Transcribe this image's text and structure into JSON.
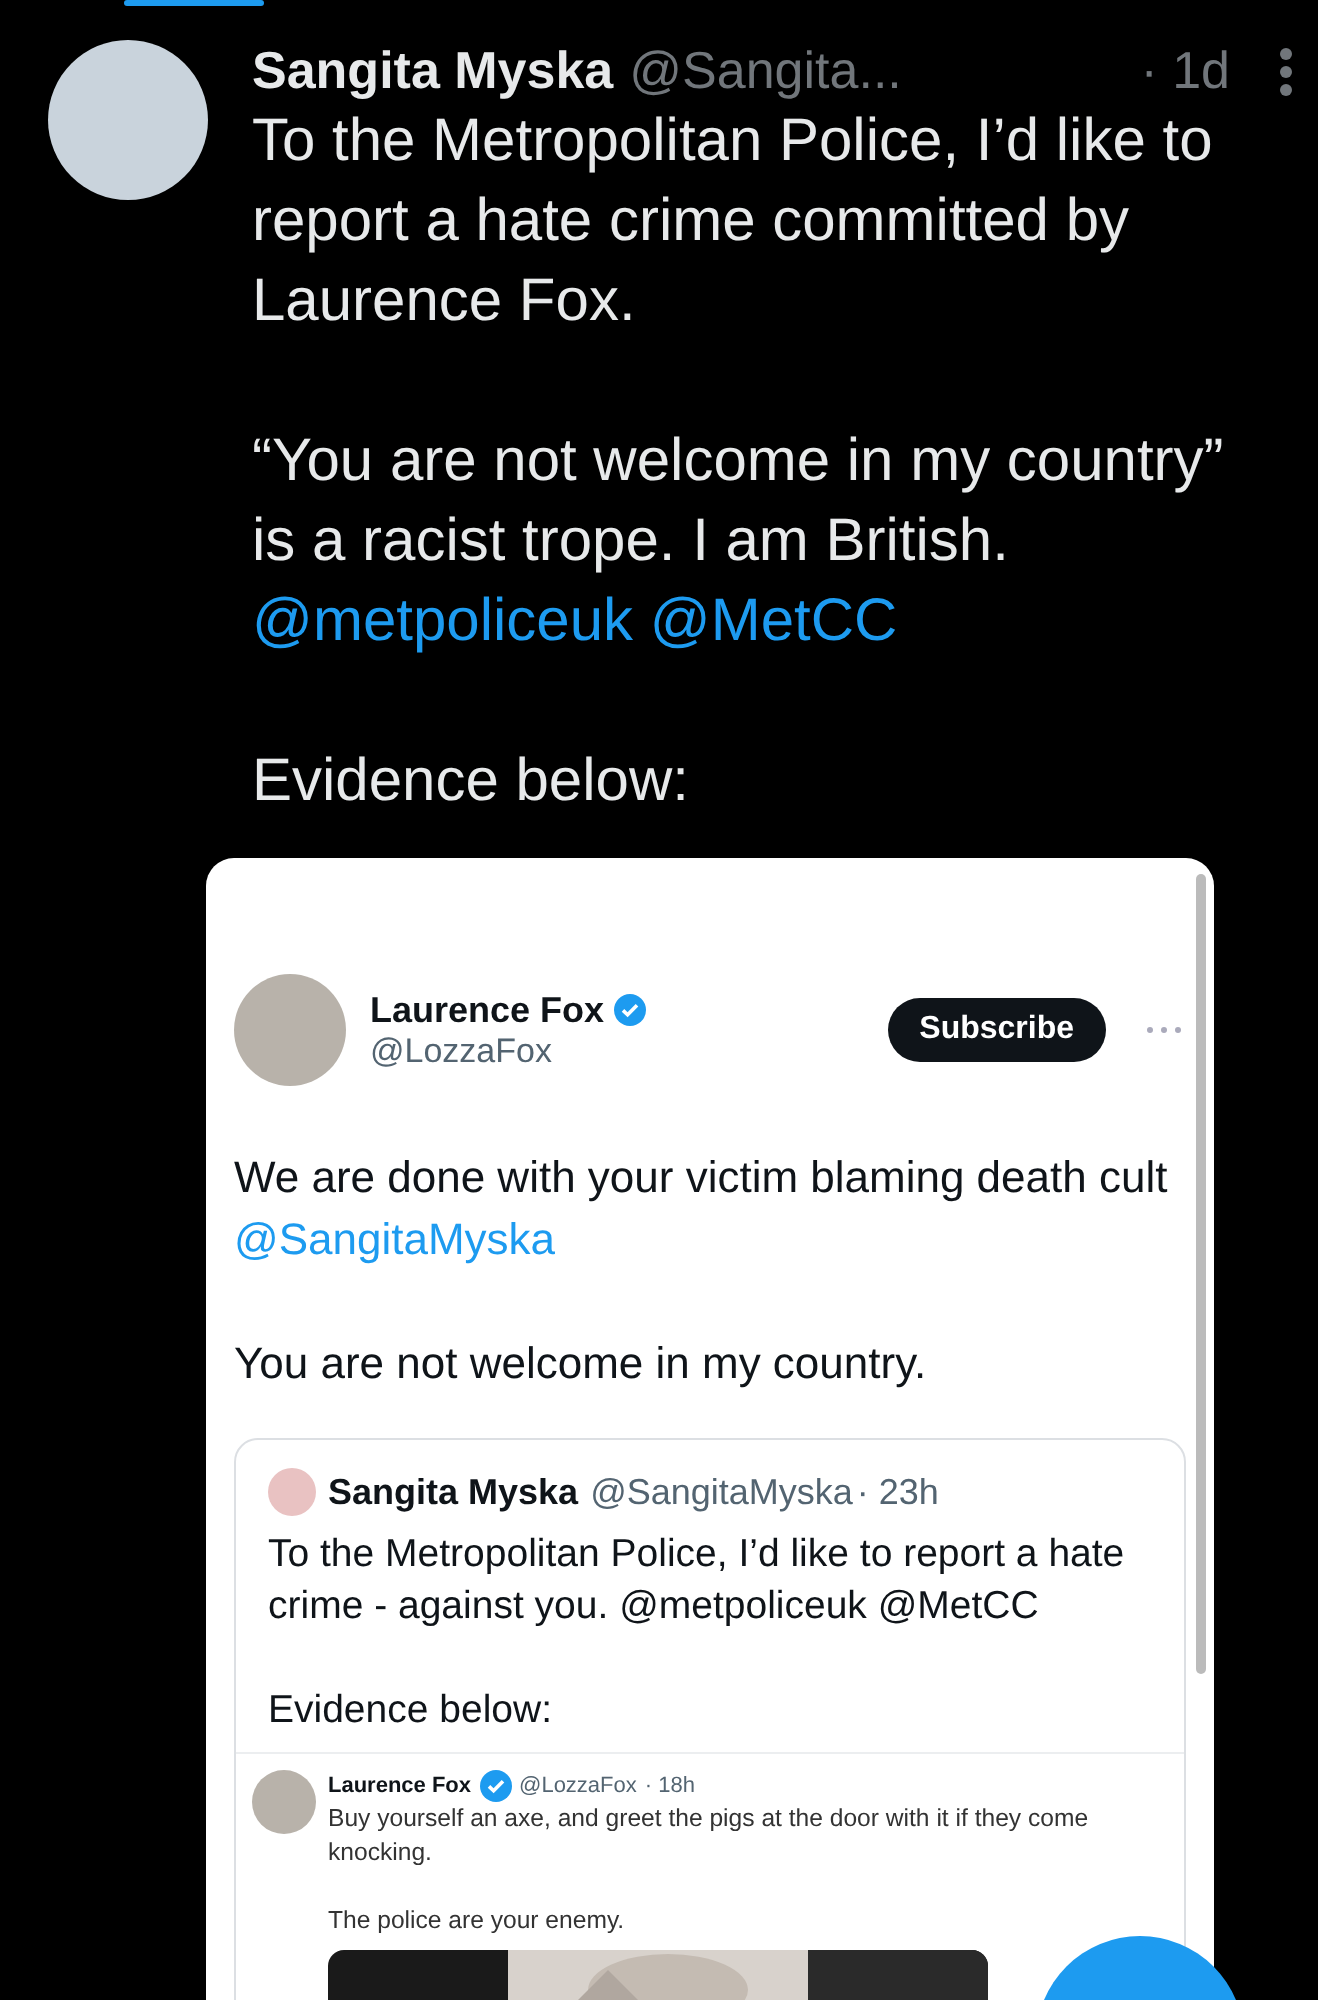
{
  "author": {
    "name": "Sangita Myska",
    "handle": "@Sangita...",
    "time": "· 1d"
  },
  "body": [
    [
      {
        "kind": "text",
        "text": "To the Metropolitan Police, I’d like to report a hate crime committed by Laurence Fox."
      }
    ],
    [
      {
        "kind": "text",
        "text": "“You are not welcome in my country” is a racist trope. I am British."
      },
      {
        "kind": "mention",
        "text": "@metpoliceuk"
      },
      {
        "kind": "mention",
        "text": "@MetCC"
      }
    ],
    [
      {
        "kind": "text",
        "text": "Evidence below:"
      }
    ]
  ],
  "screenshot": {
    "author": {
      "name": "Laurence Fox",
      "handle": "@LozzaFox",
      "verified": true
    },
    "subscribe": "Subscribe",
    "body": [
      [
        {
          "kind": "text",
          "text": "We are done with your victim blaming death cult"
        },
        {
          "kind": "mention",
          "text": "@SangitaMyska"
        }
      ],
      [
        {
          "kind": "text",
          "text": "You are not welcome in my country."
        }
      ]
    ],
    "quote": {
      "author": {
        "name": "Sangita Myska",
        "handle": "@SangitaMyska",
        "time": "· 23h"
      },
      "body": [
        [
          {
            "kind": "text",
            "text": "To the Metropolitan Police, I’d like to report a hate crime - against you."
          },
          {
            "kind": "mention",
            "text": "@metpoliceuk"
          },
          {
            "kind": "mention",
            "text": "@MetCC"
          }
        ],
        [
          {
            "kind": "text",
            "text": "Evidence below:"
          }
        ]
      ],
      "embedded": {
        "author": {
          "name": "Laurence Fox",
          "handle": "@LozzaFox",
          "time": "· 18h",
          "verified": true
        },
        "body": [
          [
            {
              "kind": "text",
              "text": "Buy yourself an axe, and greet the pigs at the door with it if they come knocking."
            }
          ],
          [
            {
              "kind": "text",
              "text": "The police are your enemy."
            }
          ]
        ],
        "media": {
          "kind": "picture"
        }
      }
    }
  }
}
